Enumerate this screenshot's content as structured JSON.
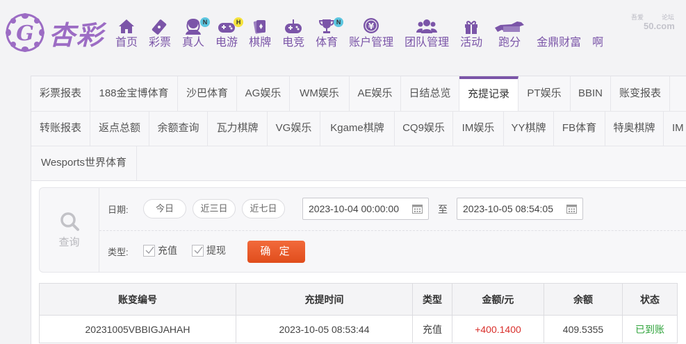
{
  "logo": {
    "text": "杏彩"
  },
  "nav": [
    {
      "label": "首页",
      "icon": "home-icon",
      "badge": ""
    },
    {
      "label": "彩票",
      "icon": "lottery-ticket-icon",
      "badge": ""
    },
    {
      "label": "真人",
      "icon": "live-dealer-icon",
      "badge": "N"
    },
    {
      "label": "电游",
      "icon": "gamepad-icon",
      "badge": "H"
    },
    {
      "label": "棋牌",
      "icon": "cards-icon",
      "badge": ""
    },
    {
      "label": "电竞",
      "icon": "esports-controller-icon",
      "badge": ""
    },
    {
      "label": "体育",
      "icon": "trophy-icon",
      "badge": "N"
    },
    {
      "label": "账户管理",
      "icon": "yen-coin-icon",
      "badge": ""
    },
    {
      "label": "团队管理",
      "icon": "team-icon",
      "badge": ""
    },
    {
      "label": "活动",
      "icon": "gift-icon",
      "badge": ""
    },
    {
      "label": "跑分",
      "icon": "running-dog-icon",
      "badge": ""
    },
    {
      "label": "金鼎财富",
      "icon": "wealth-icon",
      "badge": ""
    },
    {
      "label": "啊",
      "icon": "more-icon",
      "badge": ""
    }
  ],
  "watermark": {
    "line1": "吾爱",
    "line2": "论坛",
    "line3": "50.com"
  },
  "tabs": {
    "row1": [
      "彩票报表",
      "188金宝博体育",
      "沙巴体育",
      "AG娱乐",
      "WM娱乐",
      "AE娱乐",
      "日结总览",
      "充提记录",
      "PT娱乐",
      "BBIN",
      "账变报表"
    ],
    "row2": [
      "转账报表",
      "返点总额",
      "余额查询",
      "瓦力棋牌",
      "VG娱乐",
      "Kgame棋牌",
      "CQ9娱乐",
      "IM娱乐",
      "YY棋牌",
      "FB体育",
      "特奥棋牌",
      "IM"
    ],
    "row3": [
      "Wesports世界体育"
    ],
    "active": "充提记录"
  },
  "query": {
    "search_label": "查询",
    "date_label": "日期:",
    "quick_ranges": [
      "今日",
      "近三日",
      "近七日"
    ],
    "start": "2023-10-04 00:00:00",
    "to": "至",
    "end": "2023-10-05 08:54:05",
    "type_label": "类型:",
    "types": [
      {
        "label": "充值",
        "checked": true
      },
      {
        "label": "提现",
        "checked": true
      }
    ],
    "confirm": "确 定"
  },
  "table": {
    "headers": [
      "账变编号",
      "充提时间",
      "类型",
      "金额/元",
      "余额",
      "状态"
    ],
    "rows": [
      {
        "id": "20231005VBBIGJAHAH",
        "time": "2023-10-05 08:53:44",
        "type": "充值",
        "amount": "+400.1400",
        "balance": "409.5355",
        "status": "已到账"
      }
    ]
  },
  "colors": {
    "brand": "#7b55a8",
    "accent_button": "#e9551f",
    "amount": "#d9302c",
    "status_ok": "#2ea33a"
  }
}
